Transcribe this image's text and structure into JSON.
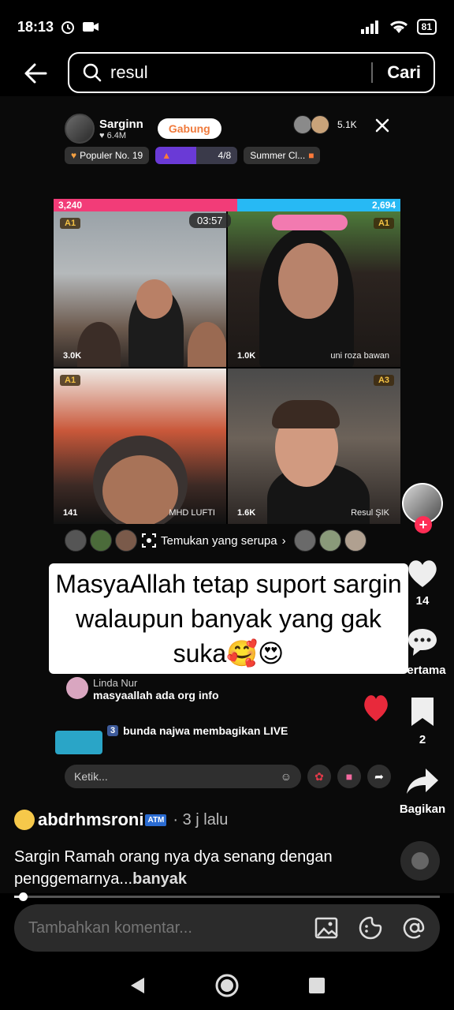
{
  "status_bar": {
    "time": "18:13",
    "battery": "81"
  },
  "search": {
    "query": "resul",
    "button_label": "Cari"
  },
  "live": {
    "host_name": "Sarginn",
    "host_likes": "♥ 6.4M",
    "join_label": "Gabung",
    "viewer_count": "5.1K",
    "popular_label": "Populer No. 19",
    "progress_text": "4/8",
    "progress_fraction": 0.5,
    "event_label": "Summer Cl...",
    "battle_left_score": "3,240",
    "battle_right_score": "2,694",
    "battle_red_fraction": 0.53,
    "timer": "03:57",
    "tiles": [
      {
        "rank": "A1",
        "score": "3.0K",
        "name": ""
      },
      {
        "rank": "A1",
        "score": "1.0K",
        "name": "uni roza bawan"
      },
      {
        "rank": "A1",
        "score": "141",
        "name": "MHD LUFTI"
      },
      {
        "rank": "A3",
        "score": "1.6K",
        "name": "Resul ŞIK"
      }
    ],
    "similar_label": "Temukan yang serupa",
    "caption": "MasyaAllah tetap suport sargin walaupun banyak yang gak suka🥰😍",
    "comment_user": "Linda Nur",
    "comment_text": "masyaallah ada org info",
    "share_tag": "3",
    "share_text": "bunda najwa membagikan LIVE",
    "type_placeholder": "Ketik..."
  },
  "rail": {
    "like_count": "14",
    "comment_label": "Pertama",
    "save_count": "2",
    "share_label": "Bagikan"
  },
  "post": {
    "author": "abdrhmsroni",
    "atm_badge": "ATM",
    "time": "· 3 j lalu",
    "description": "Sargin Ramah orang nya dya senang dengan penggemarnya...",
    "more_label": "banyak",
    "progress_fraction": 0.02
  },
  "comment_bar": {
    "placeholder": "Tambahkan komentar..."
  }
}
